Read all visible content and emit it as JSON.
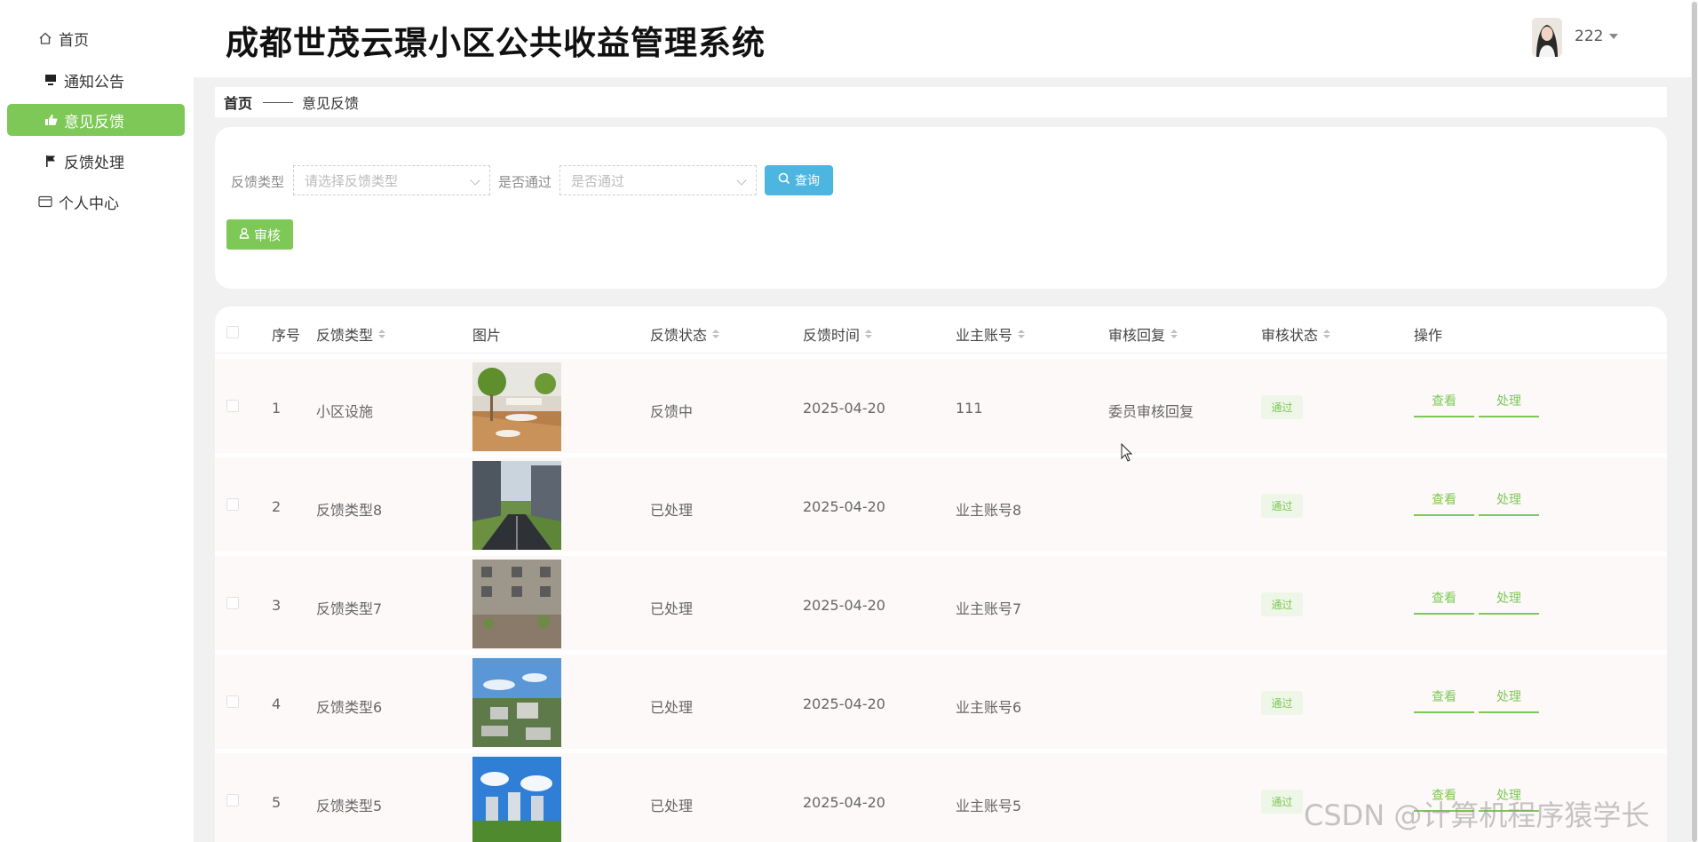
{
  "sidebar": {
    "items": [
      {
        "label": "首页",
        "icon": "home-icon"
      },
      {
        "label": "通知公告",
        "icon": "monitor-icon"
      },
      {
        "label": "意见反馈",
        "icon": "feedback-icon",
        "active": true
      },
      {
        "label": "反馈处理",
        "icon": "flag-icon"
      },
      {
        "label": "个人中心",
        "icon": "card-icon"
      }
    ]
  },
  "header": {
    "title": "成都世茂云璟小区公共收益管理系统",
    "user_name": "222"
  },
  "breadcrumb": {
    "home": "首页",
    "current": "意见反馈"
  },
  "filters": {
    "type_label": "反馈类型",
    "type_placeholder": "请选择反馈类型",
    "pass_label": "是否通过",
    "pass_placeholder": "是否通过",
    "query_label": "查询",
    "audit_label": "审核"
  },
  "table": {
    "headers": {
      "index": "序号",
      "type": "反馈类型",
      "image": "图片",
      "status": "反馈状态",
      "time": "反馈时间",
      "account": "业主账号",
      "reply": "审核回复",
      "audit_status": "审核状态",
      "actions": "操作"
    },
    "rows": [
      {
        "index": "1",
        "type": "小区设施",
        "image": "interior",
        "status": "反馈中",
        "time": "2025-04-20",
        "account": "111",
        "reply": "委员审核回复",
        "audit_status": "通过",
        "view": "查看",
        "handle": "处理"
      },
      {
        "index": "2",
        "type": "反馈类型8",
        "image": "road",
        "status": "已处理",
        "time": "2025-04-20",
        "account": "业主账号8",
        "reply": "",
        "audit_status": "通过",
        "view": "查看",
        "handle": "处理"
      },
      {
        "index": "3",
        "type": "反馈类型7",
        "image": "building",
        "status": "已处理",
        "time": "2025-04-20",
        "account": "业主账号7",
        "reply": "",
        "audit_status": "通过",
        "view": "查看",
        "handle": "处理"
      },
      {
        "index": "4",
        "type": "反馈类型6",
        "image": "aerial",
        "status": "已处理",
        "time": "2025-04-20",
        "account": "业主账号6",
        "reply": "",
        "audit_status": "通过",
        "view": "查看",
        "handle": "处理"
      },
      {
        "index": "5",
        "type": "反馈类型5",
        "image": "skyline",
        "status": "已处理",
        "time": "2025-04-20",
        "account": "业主账号5",
        "reply": "",
        "audit_status": "通过",
        "view": "查看",
        "handle": "处理"
      }
    ]
  },
  "watermark": "CSDN @计算机程序猿学长",
  "colors": {
    "accent_green": "#7dc856",
    "query_blue": "#4cb5e0",
    "row_bg": "#fdf9f9",
    "page_bg": "#f1f1f1"
  }
}
